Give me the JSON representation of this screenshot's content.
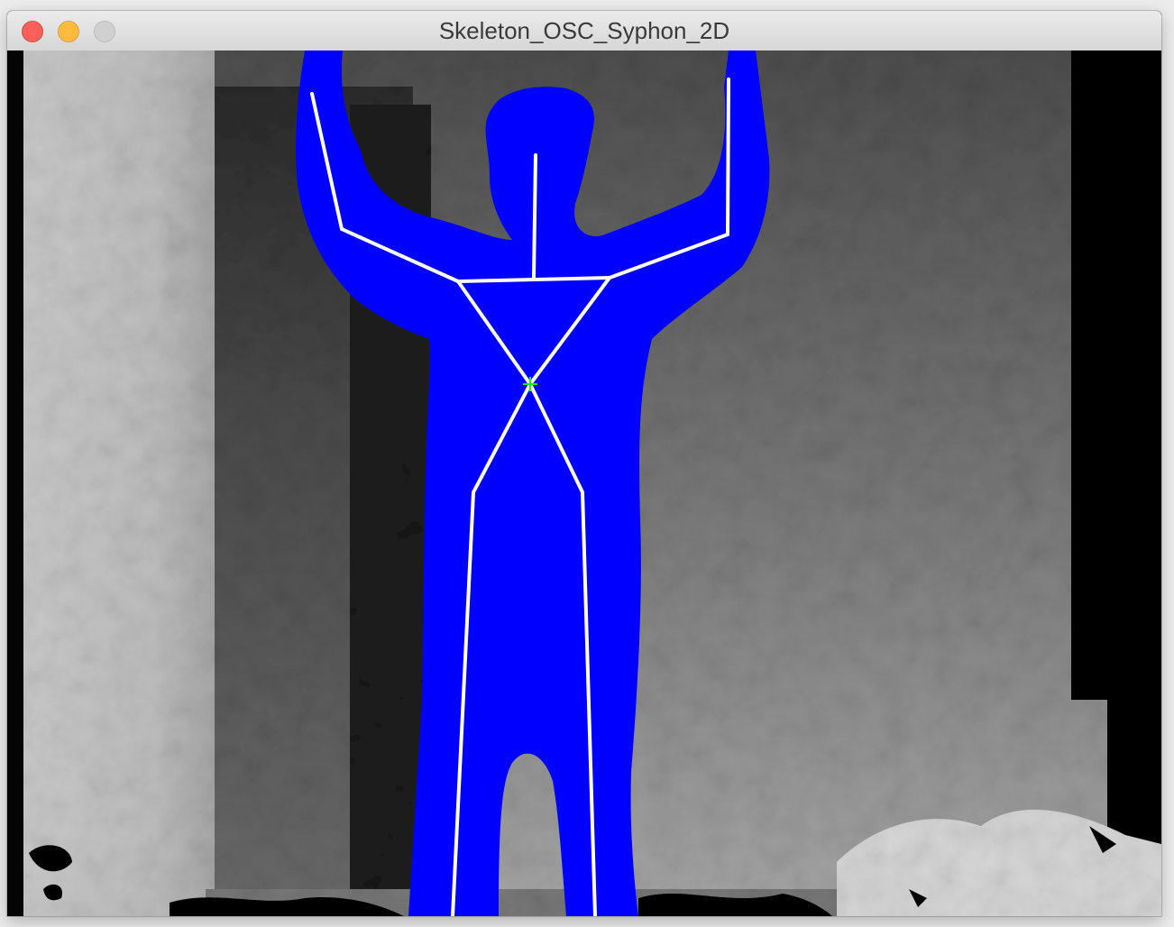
{
  "window": {
    "title": "Skeleton_OSC_Syphon_2D"
  },
  "traffic_lights": {
    "close_color": "#fc605b",
    "minimize_color": "#fdbc40",
    "zoom_color": "#d0d0d0"
  },
  "view": {
    "user_silhouette_color": "#0000ff",
    "skeleton_line_color": "#ffffff",
    "center_of_mass_marker_color": "#00ff00"
  }
}
